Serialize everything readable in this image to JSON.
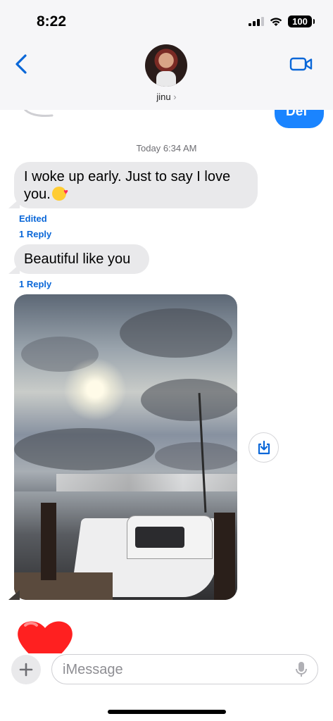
{
  "status_bar": {
    "time": "8:22",
    "battery": "100"
  },
  "header": {
    "contact_name": "jinu",
    "contact_chevron": "›",
    "icons": [
      "back-chevron-icon",
      "contact-avatar",
      "video-call-icon"
    ]
  },
  "conversation": {
    "previous_sent_message": "Def",
    "timestamp_day": "Today",
    "timestamp_time": "6:34 AM",
    "messages": [
      {
        "text": "I woke up early. Just to say I love you.",
        "emoji": "kissing-face-with-heart-emoji",
        "edited_label": "Edited",
        "reply_label": "1 Reply"
      },
      {
        "text": "Beautiful like you",
        "reply_label": "1 Reply"
      }
    ],
    "photo_message": {
      "description_icon": "photo-marina-sunset",
      "save_icon": "save-download-icon"
    },
    "reaction_emoji": "red-heart-emoji"
  },
  "composer": {
    "placeholder": "iMessage",
    "plus_icon": "plus-icon",
    "mic_icon": "microphone-icon"
  },
  "colors": {
    "blue_bubble": "#1a84ff",
    "grey_bubble": "#e9e9eb",
    "link_blue": "#0a67d8",
    "heart_red": "#ff2d2d"
  }
}
